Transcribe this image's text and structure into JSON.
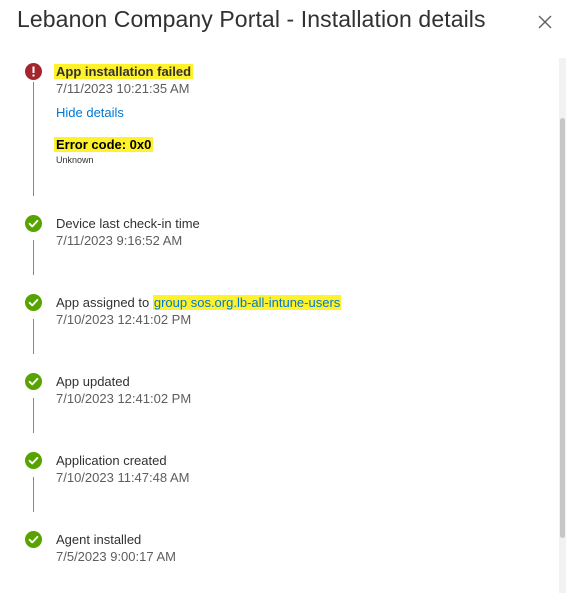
{
  "panel": {
    "title": "Lebanon Company Portal - Installation details",
    "close_label": "×"
  },
  "colors": {
    "error": "#a4262c",
    "success": "#57a300",
    "link": "#0078d4",
    "highlight": "#fff22b"
  },
  "events": [
    {
      "status": "error",
      "icon": "error-icon",
      "title": "App installation failed",
      "time": "7/11/2023 10:21:35 AM",
      "details_link": "Hide details",
      "error_code": "Error code: 0x0",
      "error_description": "Unknown"
    },
    {
      "status": "success",
      "icon": "checkmark-icon",
      "title": "Device last check-in time",
      "time": "7/11/2023 9:16:52 AM"
    },
    {
      "status": "success",
      "icon": "checkmark-icon",
      "title_prefix": "App assigned to ",
      "title_link": "group sos.org.lb-all-intune-users",
      "time": "7/10/2023 12:41:02 PM"
    },
    {
      "status": "success",
      "icon": "checkmark-icon",
      "title": "App updated",
      "time": "7/10/2023 12:41:02 PM"
    },
    {
      "status": "success",
      "icon": "checkmark-icon",
      "title": "Application created",
      "time": "7/10/2023 11:47:48 AM"
    },
    {
      "status": "success",
      "icon": "checkmark-icon",
      "title": "Agent installed",
      "time": "7/5/2023 9:00:17 AM"
    }
  ]
}
